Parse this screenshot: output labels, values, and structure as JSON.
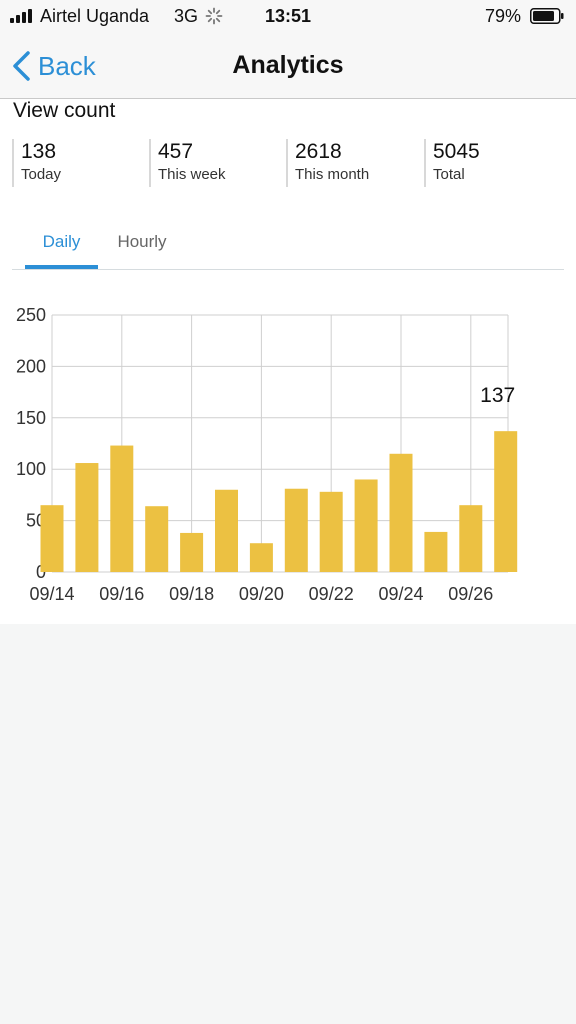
{
  "status_bar": {
    "carrier": "Airtel Uganda",
    "network": "3G",
    "time": "13:51",
    "battery_percent": "79%",
    "icons": [
      "signal-icon",
      "activity-spinner-icon",
      "battery-icon"
    ]
  },
  "nav": {
    "back_label": "Back",
    "title": "Analytics"
  },
  "view_count": {
    "title": "View count",
    "stats": [
      {
        "value": "138",
        "label": "Today"
      },
      {
        "value": "457",
        "label": "This week"
      },
      {
        "value": "2618",
        "label": "This month"
      },
      {
        "value": "5045",
        "label": "Total"
      }
    ]
  },
  "tabs": [
    {
      "label": "Daily",
      "selected": true
    },
    {
      "label": "Hourly",
      "selected": false
    }
  ],
  "colors": {
    "accent": "#2c8fd6",
    "bar": "#ecc142",
    "grid": "#cfcfcf"
  },
  "chart_data": {
    "type": "bar",
    "categories": [
      "09/14",
      "09/15",
      "09/16",
      "09/17",
      "09/18",
      "09/19",
      "09/20",
      "09/21",
      "09/22",
      "09/23",
      "09/24",
      "09/25",
      "09/26",
      "09/27"
    ],
    "values": [
      65,
      106,
      123,
      64,
      38,
      80,
      28,
      81,
      78,
      90,
      115,
      39,
      65,
      137
    ],
    "tick_labels": [
      "09/14",
      "09/16",
      "09/18",
      "09/20",
      "09/22",
      "09/24",
      "09/26"
    ],
    "yticks": [
      0,
      50,
      100,
      150,
      200,
      250
    ],
    "ylim": [
      0,
      250
    ],
    "highlight_label": "137",
    "grid": true,
    "title": "",
    "xlabel": "",
    "ylabel": ""
  }
}
